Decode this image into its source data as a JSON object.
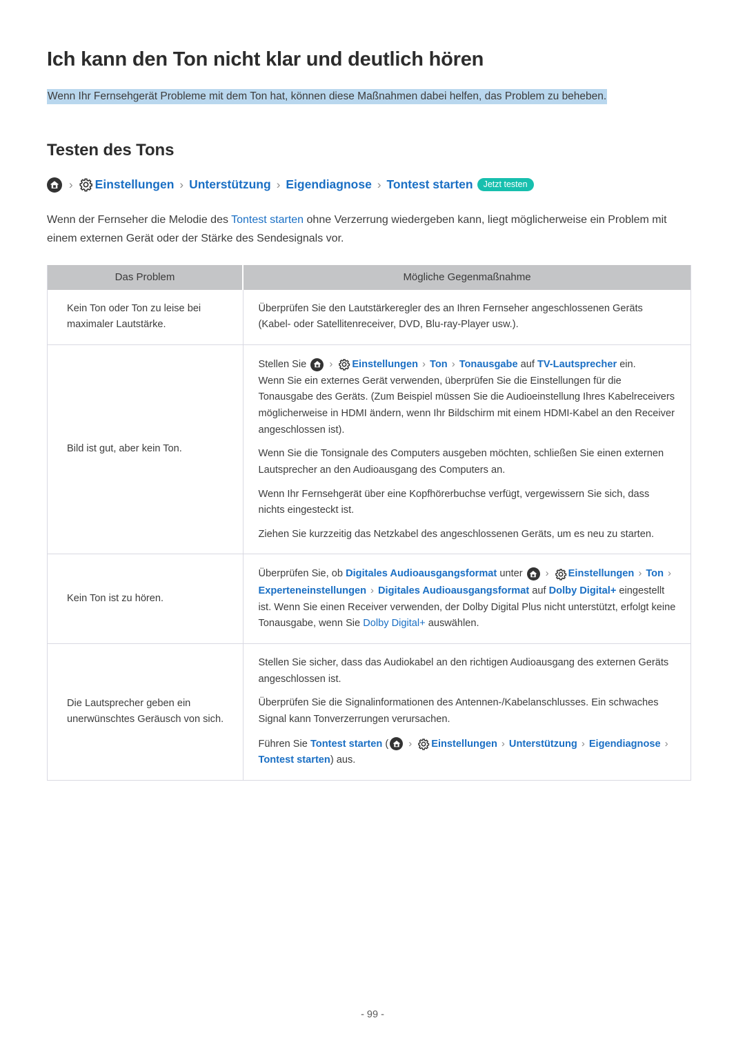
{
  "document": {
    "title": "Ich kann den Ton nicht klar und deutlich hören",
    "subtitle": "Wenn Ihr Fernsehgerät Probleme mit dem Ton hat, können diese Maßnahmen dabei helfen, das Problem zu beheben.",
    "page_number": "- 99 -"
  },
  "section": {
    "heading": "Testen des Tons",
    "breadcrumb": {
      "home_icon": "home-icon",
      "gear_icon": "gear-icon",
      "separator": "›",
      "items": [
        "Einstellungen",
        "Unterstützung",
        "Eigendiagnose",
        "Tontest starten"
      ],
      "badge": "Jetzt testen"
    },
    "intro": {
      "part1": "Wenn der Fernseher die Melodie des ",
      "link": "Tontest starten",
      "part2": " ohne Verzerrung wiedergeben kann, liegt möglicherweise ein Problem mit einem externen Gerät oder der Stärke des Sendesignals vor."
    }
  },
  "table": {
    "headers": [
      "Das Problem",
      "Mögliche Gegenmaßnahme"
    ],
    "rows": [
      {
        "problem": "Kein Ton oder Ton zu leise bei maximaler Lautstärke.",
        "measures": [
          {
            "type": "text",
            "text": "Überprüfen Sie den Lautstärkeregler des an Ihren Fernseher angeschlossenen Geräts (Kabel- oder Satellitenreceiver, DVD, Blu-ray-Player usw.)."
          }
        ]
      },
      {
        "problem": "Bild ist gut, aber kein Ton.",
        "measures": [
          {
            "type": "nav",
            "prefix": "Stellen Sie ",
            "home_icon": "home-icon",
            "gear_icon": "gear-icon",
            "links": [
              "Einstellungen",
              "Ton",
              "Tonausgabe"
            ],
            "middle": " auf ",
            "target": "TV-Lautsprecher",
            "suffix": " ein."
          },
          {
            "type": "text",
            "text": "Wenn Sie ein externes Gerät verwenden, überprüfen Sie die Einstellungen für die Tonausgabe des Geräts. (Zum Beispiel müssen Sie die Audioeinstellung Ihres Kabelreceivers möglicherweise in HDMI ändern, wenn Ihr Bildschirm mit einem HDMI-Kabel an den Receiver angeschlossen ist)."
          },
          {
            "type": "text",
            "text": "Wenn Sie die Tonsignale des Computers ausgeben möchten, schließen Sie einen externen Lautsprecher an den Audioausgang des Computers an."
          },
          {
            "type": "text",
            "text": "Wenn Ihr Fernsehgerät über eine Kopfhörerbuchse verfügt, vergewissern Sie sich, dass nichts eingesteckt ist."
          },
          {
            "type": "text",
            "text": "Ziehen Sie kurzzeitig das Netzkabel des angeschlossenen Geräts, um es neu zu starten."
          }
        ]
      },
      {
        "problem": "Kein Ton ist zu hören.",
        "measures": [
          {
            "type": "nav2",
            "prefix": "Überprüfen Sie, ob ",
            "setting": "Digitales Audioausgangsformat",
            "under": " unter ",
            "home_icon": "home-icon",
            "gear_icon": "gear-icon",
            "links": [
              "Einstellungen",
              "Ton",
              "Experteneinstellungen",
              "Digitales Audioausgangsformat"
            ],
            "middle": " auf ",
            "target": "Dolby Digital+",
            "suffix": " eingestellt ist. Wenn Sie einen Receiver verwenden, der Dolby Digital Plus nicht unterstützt, erfolgt keine Tonausgabe, wenn Sie ",
            "target2": "Dolby Digital+",
            "suffix2": " auswählen."
          }
        ]
      },
      {
        "problem": "Die Lautsprecher geben ein unerwünschtes Geräusch von sich.",
        "measures": [
          {
            "type": "text",
            "text": "Stellen Sie sicher, dass das Audiokabel an den richtigen Audioausgang des externen Geräts angeschlossen ist."
          },
          {
            "type": "text",
            "text": "Überprüfen Sie die Signalinformationen des Antennen-/Kabelanschlusses. Ein schwaches Signal kann Tonverzerrungen verursachen."
          },
          {
            "type": "nav3",
            "prefix": "Führen Sie ",
            "name": "Tontest starten",
            "open": " (",
            "home_icon": "home-icon",
            "gear_icon": "gear-icon",
            "links": [
              "Einstellungen",
              "Unterstützung",
              "Eigendiagnose",
              "Tontest starten"
            ],
            "close": ") aus."
          }
        ]
      }
    ]
  },
  "colors": {
    "link": "#1a6fc4",
    "badge": "#17bfae",
    "highlight": "#b9d7ee",
    "table_header": "#c4c5c7"
  }
}
